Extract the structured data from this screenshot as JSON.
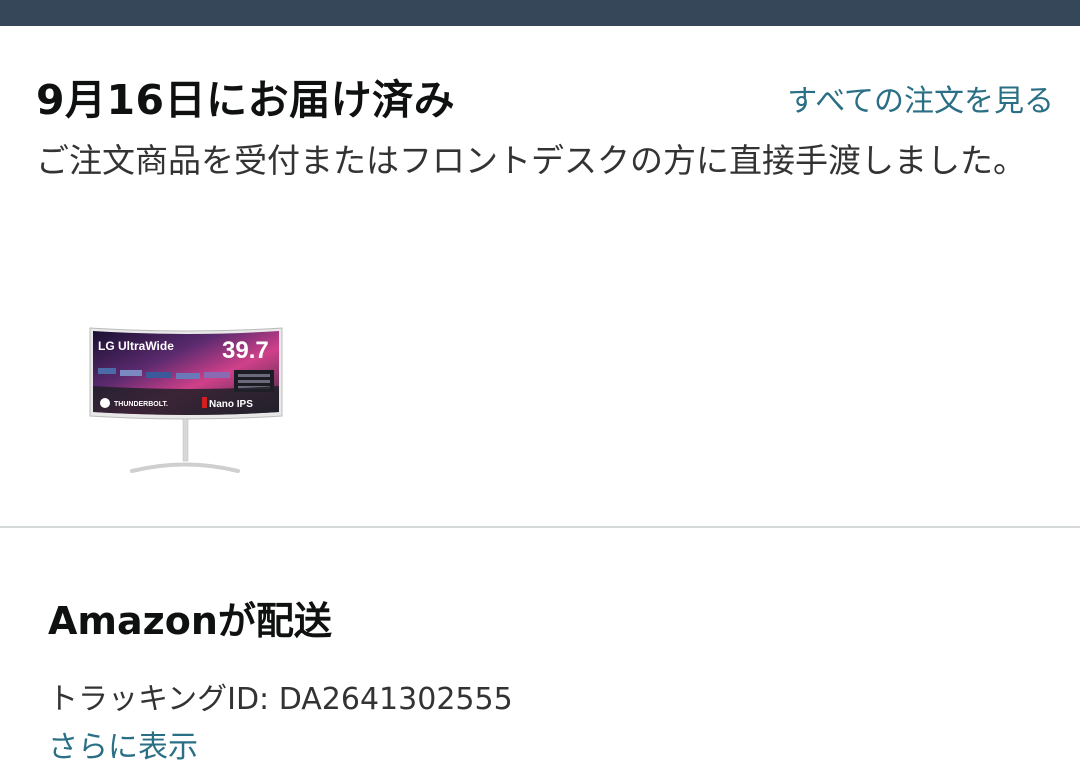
{
  "delivery": {
    "title": "9月16日にお届け済み",
    "all_orders_link": "すべての注文を見る",
    "description": "ご注文商品を受付またはフロントデスクの方に直接手渡しました。"
  },
  "product": {
    "image_text": {
      "brand": "LG UltraWide",
      "size": "39.7",
      "badge_left": "THUNDERBOLT.",
      "badge_right": "Nano IPS"
    }
  },
  "shipping": {
    "heading": "Amazonが配送",
    "tracking_label": "トラッキングID: ",
    "tracking_id": "DA2641302555",
    "show_more": "さらに表示"
  },
  "colors": {
    "top_bar": "#37475a",
    "link": "#2a6f86",
    "divider": "#d5d9d9"
  }
}
